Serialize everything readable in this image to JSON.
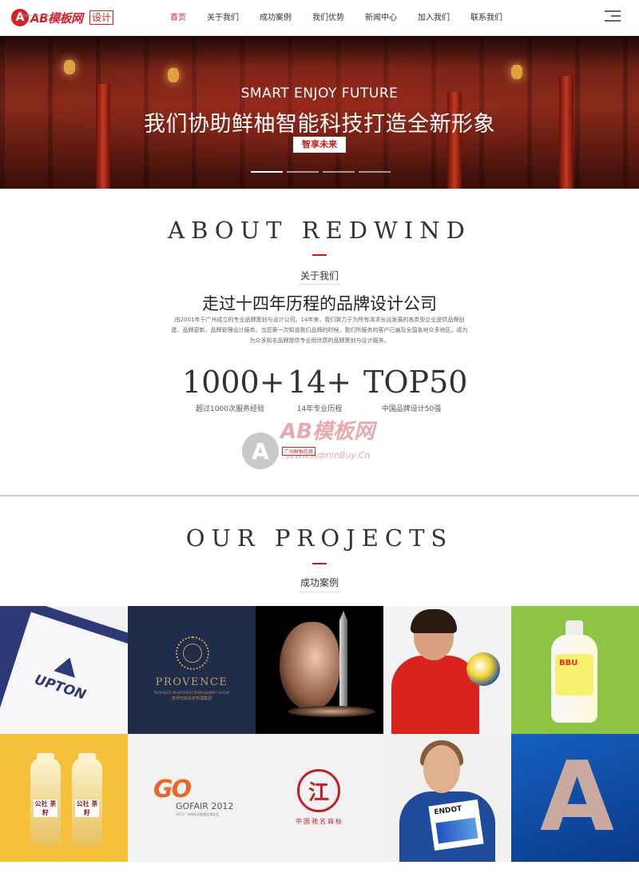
{
  "header": {
    "logo_text": "AB模板网",
    "logo_sub": "Www.AdminBuy.Cn",
    "logo_tag": "设计",
    "nav": [
      {
        "label": "首页",
        "active": true
      },
      {
        "label": "关于我们",
        "active": false
      },
      {
        "label": "成功案例",
        "active": false
      },
      {
        "label": "我们优势",
        "active": false
      },
      {
        "label": "新闻中心",
        "active": false
      },
      {
        "label": "加入我们",
        "active": false
      },
      {
        "label": "联系我们",
        "active": false
      }
    ],
    "menu_icon": "menu-icon"
  },
  "banner": {
    "title_en": "SMART ENJOY FUTURE",
    "title_zh": "我们协助鲜柚智能科技打造全新形象",
    "button_label": "智享未来",
    "slides_total": 4,
    "slide_active": 1
  },
  "about": {
    "title_en": "ABOUT REDWIND",
    "title_zh": "关于我们",
    "headline": "走过十四年历程的品牌设计公司",
    "description": "由2001年于广州成立的专业品牌策划与设计公司。14年来，我们致力于为所有渴求长远发展的各类型企业提供品牌创建、品牌更新、品牌管理设计服务，当您第一次知道我们品牌的时候，我们所服务的客户已遍及全国各地众多地区，成为为众多知名品牌提供专业而优质的品牌策划与设计服务。",
    "stats": [
      {
        "value": "1000+",
        "label": "超过1000次服务经验"
      },
      {
        "value": "14+",
        "label": "14年专业历程"
      },
      {
        "value": "TOP50",
        "label": "中国品牌设计50强"
      }
    ],
    "watermark": {
      "text": "AB模板网",
      "url": "Www.AdminBuy.Cn",
      "tag": "广州鲜柚信息"
    }
  },
  "projects": {
    "title_en": "OUR PROJECTS",
    "title_zh": "成功案例",
    "items": [
      {
        "brand": "UPTON"
      },
      {
        "brand": "PROVENCE",
        "sub": "PROVENCE INVESTMENT MANAGEMENT GROUP",
        "sub2": "普罗旺斯投资管理集团"
      },
      {
        "brand": ""
      },
      {
        "brand": ""
      },
      {
        "brand": "BBU"
      },
      {
        "brand": "公社 茶籽"
      },
      {
        "brand": "GOFAIR 2012",
        "logo": "GO",
        "sub": "2012广州国际会展服务博览会"
      },
      {
        "brand": "中国驰名商标",
        "logo": "江"
      },
      {
        "brand": "ENDOT"
      },
      {
        "brand": "A"
      }
    ]
  }
}
